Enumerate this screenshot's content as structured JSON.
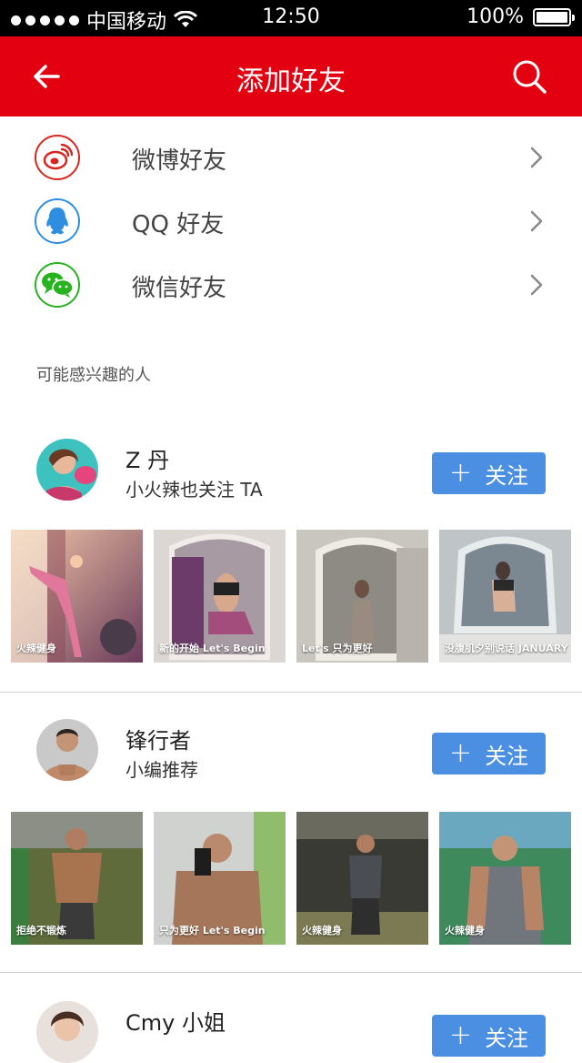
{
  "status_bar": {
    "carrier": "中国移动",
    "time": "12:50",
    "battery": "100%"
  },
  "nav": {
    "title": "添加好友"
  },
  "sources": [
    {
      "label": "微博好友",
      "color": "#d7261f",
      "icon": "weibo-icon"
    },
    {
      "label": "QQ 好友",
      "color": "#2f8ee0",
      "icon": "qq-icon"
    },
    {
      "label": "微信好友",
      "color": "#27b21f",
      "icon": "wechat-icon"
    }
  ],
  "section_label": "可能感兴趣的人",
  "people": [
    {
      "name": "Z 丹",
      "subtitle": "小火辣也关注 TA",
      "follow_label": "关注",
      "thumb_captions": [
        "火辣健身",
        "新的开始 Let's Begin",
        "Let's 只为更好",
        "没腹肌夕别说话 JANUARY"
      ]
    },
    {
      "name": "锋行者",
      "subtitle": "小编推荐",
      "follow_label": "关注",
      "thumb_captions": [
        "拒绝不锻炼",
        "只为更好 Let's Begin",
        "火辣健身",
        "火辣健身"
      ]
    },
    {
      "name": "Cmy 小姐",
      "subtitle": "",
      "follow_label": "关注",
      "thumb_captions": []
    }
  ],
  "colors": {
    "brand_red": "#e30010",
    "follow_blue": "#4a8fe2"
  }
}
